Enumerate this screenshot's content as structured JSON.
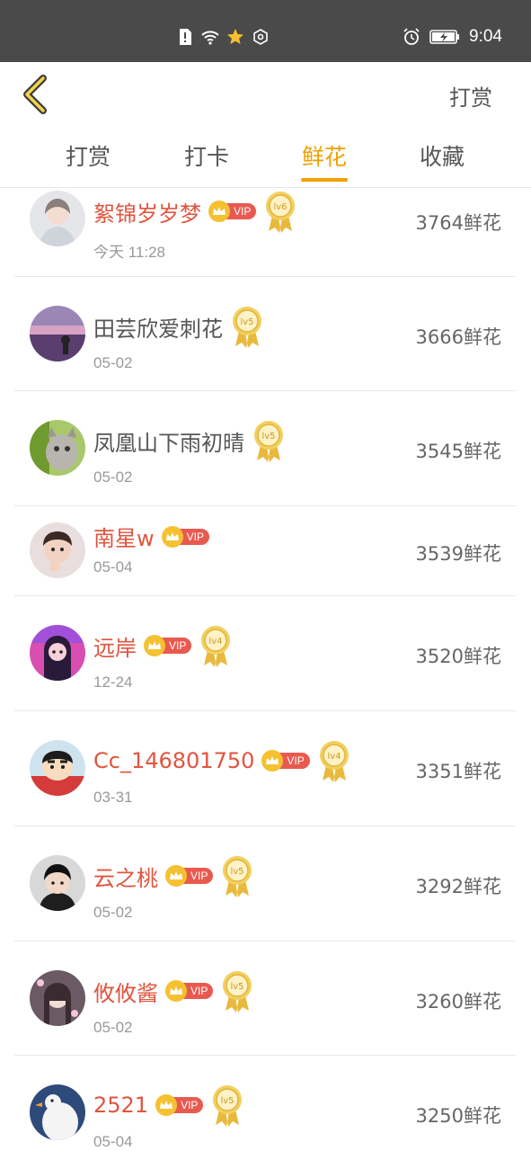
{
  "status_bar": {
    "time": "9:04"
  },
  "header": {
    "reward_link": "打赏"
  },
  "tabs": [
    {
      "label": "打赏",
      "active": false
    },
    {
      "label": "打卡",
      "active": false
    },
    {
      "label": "鲜花",
      "active": true
    },
    {
      "label": "收藏",
      "active": false
    }
  ],
  "vip_label": "VIP",
  "colors": {
    "accent": "#f0a000",
    "vip_name": "#e0553f",
    "vip_badge": "#e85a50",
    "crown": "#f5c131",
    "status_bar": "#4a4a4a"
  },
  "rows": [
    {
      "name": "絮锦岁岁梦",
      "vip": true,
      "level": "lv6",
      "date": "今天 11:28",
      "flowers": "3764鲜花"
    },
    {
      "name": "田芸欣爱刺花",
      "vip": false,
      "level": "lv5",
      "date": "05-02",
      "flowers": "3666鲜花"
    },
    {
      "name": "凤凰山下雨初晴",
      "vip": false,
      "level": "lv5",
      "date": "05-02",
      "flowers": "3545鲜花"
    },
    {
      "name": "南星w",
      "vip": true,
      "level": "",
      "date": "05-04",
      "flowers": "3539鲜花"
    },
    {
      "name": "远岸",
      "vip": true,
      "level": "lv4",
      "date": "12-24",
      "flowers": "3520鲜花"
    },
    {
      "name": "Cc_146801750",
      "vip": true,
      "level": "lv4",
      "date": "03-31",
      "flowers": "3351鲜花"
    },
    {
      "name": "云之桃",
      "vip": true,
      "level": "lv5",
      "date": "05-02",
      "flowers": "3292鲜花"
    },
    {
      "name": "攸攸酱",
      "vip": true,
      "level": "lv5",
      "date": "05-02",
      "flowers": "3260鲜花"
    },
    {
      "name": "2521",
      "vip": true,
      "level": "lv5",
      "date": "05-04",
      "flowers": "3250鲜花"
    }
  ]
}
